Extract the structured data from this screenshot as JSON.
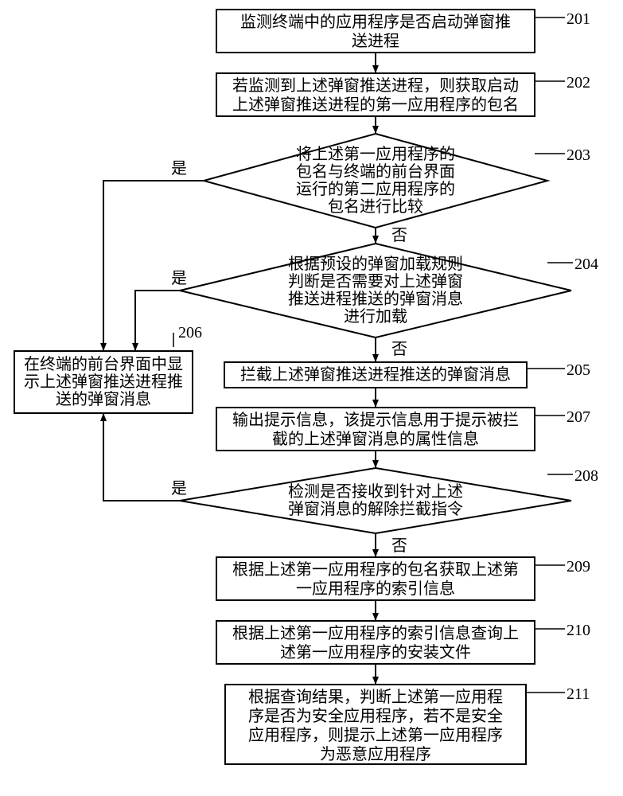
{
  "steps": {
    "201": {
      "num": "201",
      "lines": [
        "监测终端中的应用程序是否启动弹窗推",
        "送进程"
      ]
    },
    "202": {
      "num": "202",
      "lines": [
        "若监测到上述弹窗推送进程，则获取启动",
        "上述弹窗推送进程的第一应用程序的包名"
      ]
    },
    "203": {
      "num": "203",
      "lines": [
        "将上述第一应用程序的",
        "包名与终端的前台界面",
        "运行的第二应用程序的",
        "包名进行比较"
      ]
    },
    "204": {
      "num": "204",
      "lines": [
        "根据预设的弹窗加载规则",
        "判断是否需要对上述弹窗",
        "推送进程推送的弹窗消息",
        "进行加载"
      ]
    },
    "205": {
      "num": "205",
      "lines": [
        "拦截上述弹窗推送进程推送的弹窗消息"
      ]
    },
    "206": {
      "num": "206",
      "lines": [
        "在终端的前台界面中显",
        "示上述弹窗推送进程推",
        "送的弹窗消息"
      ]
    },
    "207": {
      "num": "207",
      "lines": [
        "输出提示信息，该提示信息用于提示被拦",
        "截的上述弹窗消息的属性信息"
      ]
    },
    "208": {
      "num": "208",
      "lines": [
        "检测是否接收到针对上述",
        "弹窗消息的解除拦截指令"
      ]
    },
    "209": {
      "num": "209",
      "lines": [
        "根据上述第一应用程序的包名获取上述第",
        "一应用程序的索引信息"
      ]
    },
    "210": {
      "num": "210",
      "lines": [
        "根据上述第一应用程序的索引信息查询上",
        "述第一应用程序的安装文件"
      ]
    },
    "211": {
      "num": "211",
      "lines": [
        "根据查询结果，判断上述第一应用程",
        "序是否为安全应用程序，若不是安全",
        "应用程序，则提示上述第一应用程序",
        "为恶意应用程序"
      ]
    }
  },
  "labels": {
    "yes": "是",
    "no": "否"
  }
}
